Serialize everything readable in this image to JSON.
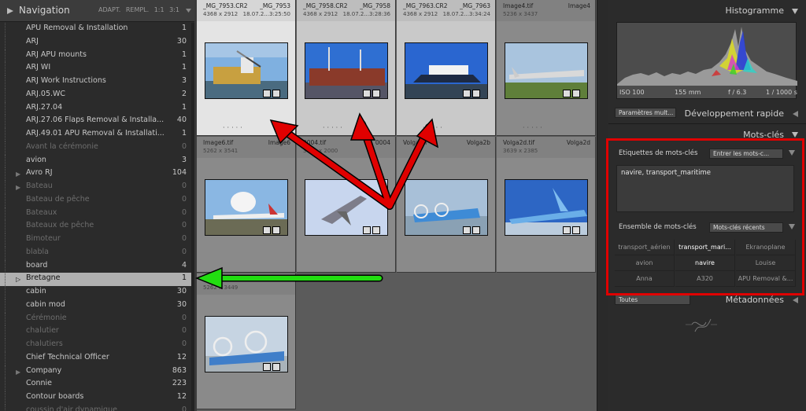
{
  "navigator": {
    "title": "Navigation",
    "options": [
      "ADAPT.",
      "REMPL.",
      "1:1",
      "3:1"
    ]
  },
  "keywords": [
    {
      "label": "APU Removal & Installation",
      "count": "1",
      "dim": false,
      "expander": false
    },
    {
      "label": "ARJ",
      "count": "30",
      "dim": false,
      "expander": false
    },
    {
      "label": "ARJ APU mounts",
      "count": "1",
      "dim": false,
      "expander": false
    },
    {
      "label": "ARJ WI",
      "count": "1",
      "dim": false,
      "expander": false
    },
    {
      "label": "ARJ Work Instructions",
      "count": "3",
      "dim": false,
      "expander": false
    },
    {
      "label": "ARJ.05.WC",
      "count": "2",
      "dim": false,
      "expander": false
    },
    {
      "label": "ARJ.27.04",
      "count": "1",
      "dim": false,
      "expander": false
    },
    {
      "label": "ARJ.27.06 Flaps Removal & Installa...",
      "count": "40",
      "dim": false,
      "expander": false
    },
    {
      "label": "ARJ.49.01 APU Removal & Installati...",
      "count": "1",
      "dim": false,
      "expander": false
    },
    {
      "label": "Avant la cérémonie",
      "count": "0",
      "dim": true,
      "expander": false
    },
    {
      "label": "avion",
      "count": "3",
      "dim": false,
      "expander": false
    },
    {
      "label": "Avro RJ",
      "count": "104",
      "dim": false,
      "expander": true
    },
    {
      "label": "Bateau",
      "count": "0",
      "dim": true,
      "expander": true
    },
    {
      "label": "Bateau de pêche",
      "count": "0",
      "dim": true,
      "expander": false
    },
    {
      "label": "Bateaux",
      "count": "0",
      "dim": true,
      "expander": false
    },
    {
      "label": "Bateaux de pêche",
      "count": "0",
      "dim": true,
      "expander": false
    },
    {
      "label": "Bimoteur",
      "count": "0",
      "dim": true,
      "expander": false
    },
    {
      "label": "blabla",
      "count": "0",
      "dim": true,
      "expander": false
    },
    {
      "label": "board",
      "count": "4",
      "dim": false,
      "expander": false
    },
    {
      "label": "Bretagne",
      "count": "1",
      "dim": false,
      "expander": true,
      "selected": true
    },
    {
      "label": "cabin",
      "count": "30",
      "dim": false,
      "expander": false
    },
    {
      "label": "cabin mod",
      "count": "30",
      "dim": false,
      "expander": false
    },
    {
      "label": "Cérémonie",
      "count": "0",
      "dim": true,
      "expander": false
    },
    {
      "label": "chalutier",
      "count": "0",
      "dim": true,
      "expander": false
    },
    {
      "label": "chalutiers",
      "count": "0",
      "dim": true,
      "expander": false
    },
    {
      "label": "Chief Technical Officer",
      "count": "12",
      "dim": false,
      "expander": false
    },
    {
      "label": "Company",
      "count": "863",
      "dim": false,
      "expander": true
    },
    {
      "label": "Connie",
      "count": "223",
      "dim": false,
      "expander": false
    },
    {
      "label": "Contour boards",
      "count": "12",
      "dim": false,
      "expander": false
    },
    {
      "label": "coussin d'air dynamique",
      "count": "0",
      "dim": true,
      "expander": false
    }
  ],
  "grid": [
    {
      "fname": "_MG_7953.CR2",
      "name2": "_MG_7953",
      "dims": "4368 x 2912",
      "date": "18.07.2...3:25:50",
      "state": "light",
      "scene": "port"
    },
    {
      "fname": "_MG_7958.CR2",
      "name2": "_MG_7958",
      "dims": "4368 x 2912",
      "date": "18.07.2...3:28:36",
      "state": "sel",
      "scene": "cargo"
    },
    {
      "fname": "_MG_7963.CR2",
      "name2": "_MG_7963",
      "dims": "4368 x 2912",
      "date": "18.07.2...3:34:24",
      "state": "sel",
      "scene": "yacht"
    },
    {
      "fname": "Image4.tif",
      "name2": "Image4",
      "dims": "5236 x 3437",
      "date": "",
      "state": "normal",
      "scene": "jet"
    },
    {
      "fname": "Image6.tif",
      "name2": "Image6",
      "dims": "5262 x 3541",
      "date": "",
      "state": "normal",
      "scene": "beluga"
    },
    {
      "fname": "0004.tif",
      "name2": "0004",
      "dims": "3000 x 2000",
      "date": "",
      "state": "normal",
      "scene": "fighter"
    },
    {
      "fname": "Volga.tif",
      "name2": "Volga2b",
      "dims": "",
      "date": "",
      "state": "normal",
      "scene": "hover"
    },
    {
      "fname": "Volga2d.tif",
      "name2": "Volga2d",
      "dims": "3639 x 2385",
      "date": "",
      "state": "normal",
      "scene": "wig"
    },
    {
      "fname": "",
      "name2": "",
      "dims": "5262 x 3449",
      "date": "",
      "state": "normal",
      "scene": "hover2"
    }
  ],
  "right": {
    "histogram_title": "Histogramme",
    "iso": "ISO 100",
    "focal": "155 mm",
    "aperture": "f / 6.3",
    "shutter": "1 / 1000 s",
    "quick_dev_preset": "Paramètres mult...",
    "quick_dev_title": "Développement rapide",
    "keywords_title": "Mots-clés",
    "tags_label": "Etiquettes de mots-clés",
    "tags_mode": "Entrer les mots-c...",
    "tags_value": "navire, transport_maritime",
    "set_label": "Ensemble de mots-clés",
    "set_mode": "Mots-clés récents",
    "set_items": [
      {
        "label": "transport_aérien",
        "on": false
      },
      {
        "label": "transport_mari...",
        "on": true
      },
      {
        "label": "Ekranoplane",
        "on": false
      },
      {
        "label": "avion",
        "on": false
      },
      {
        "label": "navire",
        "on": true
      },
      {
        "label": "Louise",
        "on": false
      },
      {
        "label": "Anna",
        "on": false
      },
      {
        "label": "A320",
        "on": false
      },
      {
        "label": "APU Removal &...",
        "on": false
      }
    ],
    "metadata_preset": "Toutes",
    "metadata_title": "Métadonnées"
  },
  "colors": {
    "annotation_red": "#e00000",
    "annotation_green": "#22dd11"
  }
}
